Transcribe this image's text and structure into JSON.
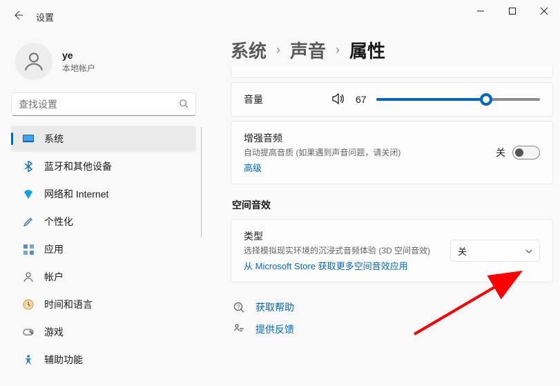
{
  "window": {
    "title": "设置"
  },
  "user": {
    "name": "ye",
    "account_type": "本地帐户"
  },
  "search": {
    "placeholder": "查找设置"
  },
  "nav": [
    {
      "key": "system",
      "label": "系统",
      "icon_color": "#0067c0",
      "active": true
    },
    {
      "key": "bluetooth",
      "label": "蓝牙和其他设备",
      "icon_color": "#0067c0"
    },
    {
      "key": "network",
      "label": "网络和 Internet",
      "icon_color": "#0aa3e6"
    },
    {
      "key": "personalization",
      "label": "个性化",
      "icon_color": "#6b6b6b"
    },
    {
      "key": "apps",
      "label": "应用",
      "icon_color": "#6b6b6b"
    },
    {
      "key": "accounts",
      "label": "帐户",
      "icon_color": "#6b6b6b"
    },
    {
      "key": "time",
      "label": "时间和语言",
      "icon_color": "#e8a33d"
    },
    {
      "key": "gaming",
      "label": "游戏",
      "icon_color": "#6b6b6b"
    },
    {
      "key": "accessibility",
      "label": "辅助功能",
      "icon_color": "#3a80d8"
    }
  ],
  "breadcrumb": {
    "root": "系统",
    "mid": "声音",
    "current": "属性"
  },
  "volume": {
    "label": "音量",
    "value": 67
  },
  "enhance": {
    "title": "增强音频",
    "sub": "自动提高音质 (如果遇到声音问题，请关闭)",
    "advanced": "高级",
    "state_label": "关"
  },
  "spatial": {
    "heading": "空间音效",
    "type_label": "类型",
    "type_sub": "选择模拟现实环境的沉浸式音频体验 (3D 空间音效)",
    "store_link": "从 Microsoft Store 获取更多空间音效应用",
    "dropdown_value": "关"
  },
  "footer": {
    "help": "获取帮助",
    "feedback": "提供反馈"
  }
}
